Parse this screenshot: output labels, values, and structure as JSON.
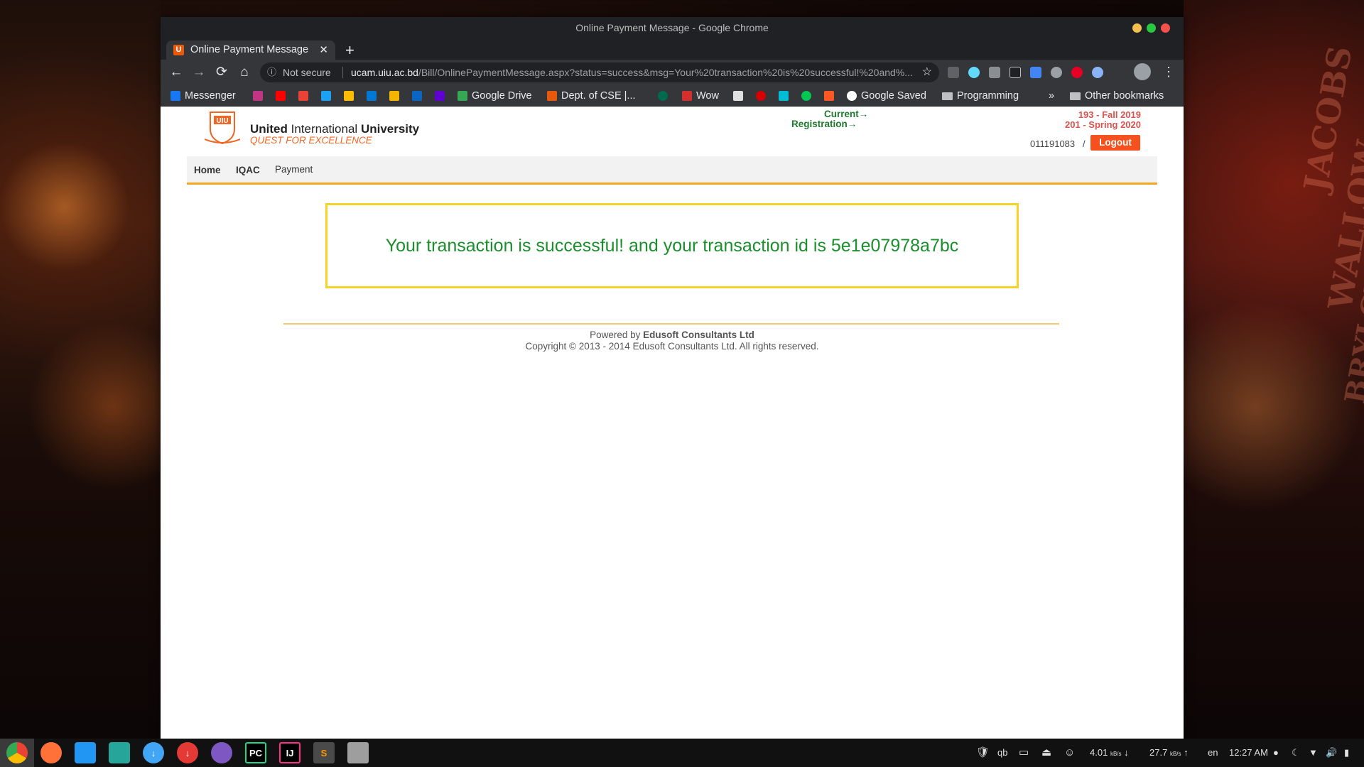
{
  "window": {
    "title": "Online Payment Message - Google Chrome",
    "controls": {
      "minimize_color": "#f5bf4f",
      "maximize_color": "#27c93f",
      "close_color": "#f4514c"
    }
  },
  "tab": {
    "title": "Online Payment Message",
    "close": "✕",
    "favicon": "U"
  },
  "newtab": "+",
  "toolbar": {
    "back": "←",
    "forward": "→",
    "reload": "⟳",
    "home": "⌂",
    "info": "ⓘ",
    "not_secure": "Not secure",
    "url_host": "ucam.uiu.ac.bd",
    "url_path": "/Bill/OnlinePaymentMessage.aspx?status=success&msg=Your%20transaction%20is%20successful!%20and%...",
    "star": "☆",
    "menu": "⋮"
  },
  "bookmarks": [
    {
      "label": "Messenger",
      "color": "#1877f2"
    },
    {
      "label": "",
      "color": "#c13584"
    },
    {
      "label": "",
      "color": "#ff0000"
    },
    {
      "label": "",
      "color": "#ea4335"
    },
    {
      "label": "",
      "color": "#1da1f2"
    },
    {
      "label": "",
      "color": "#fbbc04"
    },
    {
      "label": "",
      "color": "#0078d4"
    },
    {
      "label": "",
      "color": "#f4b400"
    },
    {
      "label": "",
      "color": "#0a66c2"
    },
    {
      "label": "",
      "color": "#6001d2"
    },
    {
      "label": "Google Drive",
      "color": "#34a853"
    },
    {
      "label": "Dept. of CSE |...",
      "color": "#e8590c"
    },
    {
      "label": "",
      "color": "#006a4e"
    },
    {
      "label": "Wow",
      "color": "#d32f2f"
    },
    {
      "label": "",
      "color": "#e0e0e0"
    },
    {
      "label": "",
      "color": "#d50000"
    },
    {
      "label": "",
      "color": "#00bcd4"
    },
    {
      "label": "",
      "color": "#00c853"
    },
    {
      "label": "",
      "color": "#ff5722"
    },
    {
      "label": "Google Saved",
      "color": "#ffffff"
    },
    {
      "label": "Programming",
      "color": "#bdc1c6"
    }
  ],
  "bookmarks_overflow": "»",
  "other_bookmarks": "Other bookmarks",
  "site": {
    "logo_initials": "UIU",
    "university_name_bold": "United",
    "university_name_rest": "International",
    "university_name_bold2": "University",
    "tagline": "QUEST FOR EXCELLENCE",
    "current_label": "Current",
    "registration_label": "Registration",
    "arrow": "→",
    "current_value": "193 - Fall 2019",
    "registration_value": "201 - Spring 2020",
    "student_id": "011191083",
    "slash": "/",
    "logout": "Logout",
    "nav": {
      "home": "Home",
      "iqac": "IQAC",
      "payment": "Payment"
    },
    "message": "Your transaction is successful! and your transaction id is 5e1e07978a7bc",
    "footer_powered_prefix": "Powered by",
    "footer_powered_company": "Edusoft Consultants Ltd",
    "footer_copyright": "Copyright © 2013 - 2014 Edusoft Consultants Ltd. All rights reserved."
  },
  "taskbar": {
    "apps": [
      {
        "name": "chrome",
        "glyph": "",
        "color": "#4285f4"
      },
      {
        "name": "firefox",
        "glyph": "",
        "color": "#ff7139"
      },
      {
        "name": "files",
        "glyph": "",
        "color": "#2196f3"
      },
      {
        "name": "image-viewer",
        "glyph": "",
        "color": "#26a69a"
      },
      {
        "name": "downloader",
        "glyph": "↓",
        "color": "#42a5f5"
      },
      {
        "name": "download-manager",
        "glyph": "↓",
        "color": "#e53935"
      },
      {
        "name": "tor-browser",
        "glyph": "",
        "color": "#7e57c2"
      },
      {
        "name": "pycharm",
        "glyph": "PC",
        "color": "#21d789"
      },
      {
        "name": "intellij",
        "glyph": "IJ",
        "color": "#fc318c"
      },
      {
        "name": "sublime-text",
        "glyph": "S",
        "color": "#ff9800"
      },
      {
        "name": "disk-utility",
        "glyph": "",
        "color": "#9e9e9e"
      }
    ],
    "tray": {
      "qb": "qb",
      "down_speed": "4.01",
      "down_unit": "kB/s",
      "down_arrow": "↓",
      "up_speed": "27.7",
      "up_unit": "kB/s",
      "up_arrow": "↑",
      "lang": "en",
      "time": "12:27 AM"
    }
  }
}
